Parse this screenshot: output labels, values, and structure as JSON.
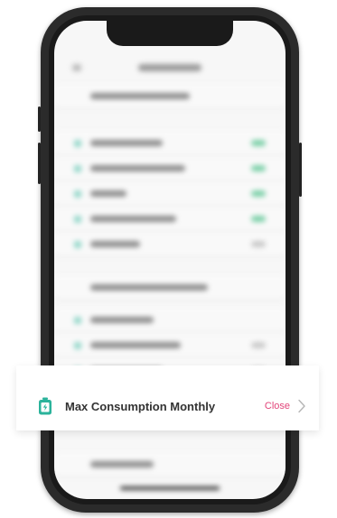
{
  "setting_row": {
    "label": "Max Consumption Monthly",
    "value": "Close",
    "icon": "battery-icon",
    "chevron_icon": "chevron-right-icon"
  },
  "colors": {
    "accent_teal": "#2bb39b",
    "value_pink": "#e2457a"
  }
}
